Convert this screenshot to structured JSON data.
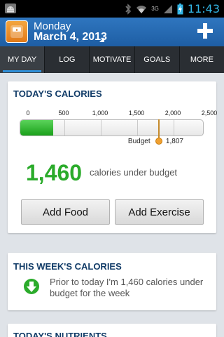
{
  "status_bar": {
    "time": "11:43",
    "network": "3G",
    "icons": [
      "android-icon",
      "bluetooth-icon",
      "wifi-icon",
      "signal-icon",
      "battery-charging-icon"
    ]
  },
  "header": {
    "day": "Monday",
    "date": "March 4, 2013",
    "add_icon": "plus-icon",
    "logo_icon": "scale-logo-icon"
  },
  "tabs": [
    {
      "label": "MY DAY",
      "active": true
    },
    {
      "label": "LOG",
      "active": false
    },
    {
      "label": "MOTIVATE",
      "active": false
    },
    {
      "label": "GOALS",
      "active": false
    },
    {
      "label": "MORE",
      "active": false
    }
  ],
  "todays_calories": {
    "title": "TODAY'S CALORIES",
    "scale_ticks": [
      "0",
      "500",
      "1,000",
      "1,500",
      "2,000",
      "2,500"
    ],
    "scale_max": 2500,
    "consumed": 347,
    "budget_label": "Budget",
    "budget_value": "1,807",
    "budget_amount": 1807,
    "under_number": "1,460",
    "under_text": "calories under budget",
    "add_food_label": "Add Food",
    "add_exercise_label": "Add Exercise"
  },
  "weeks_calories": {
    "title": "THIS WEEK'S CALORIES",
    "message": "Prior to today I'm 1,460 calories under budget for the week",
    "icon": "down-arrow-circle-icon"
  },
  "todays_nutrients": {
    "title": "TODAY'S NUTRIENTS"
  },
  "colors": {
    "header_blue": "#2f76bf",
    "tab_bar": "#2a2e33",
    "tab_indicator": "#2f8fd8",
    "green": "#2bab2b",
    "title_navy": "#123c68",
    "clock_blue": "#33b5e5"
  }
}
